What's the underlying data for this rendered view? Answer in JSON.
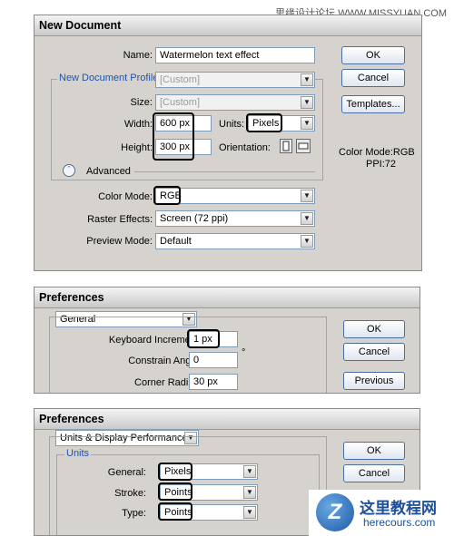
{
  "watermark": {
    "top_right": "思缘设计论坛 WWW.MISSYUAN.COM",
    "logo_cn": "这里教程网",
    "logo_url": "herecours.com",
    "logo_letter": "Z"
  },
  "new_doc": {
    "title": "New Document",
    "name_label": "Name:",
    "name_value": "Watermelon text effect",
    "profile_label": "New Document Profile:",
    "profile_value": "[Custom]",
    "size_label": "Size:",
    "size_value": "[Custom]",
    "width_label": "Width:",
    "width_value": "600 px",
    "units_label": "Units:",
    "units_value": "Pixels",
    "height_label": "Height:",
    "height_value": "300 px",
    "orientation_label": "Orientation:",
    "advanced_label": "Advanced",
    "colormode_label": "Color Mode:",
    "colormode_value": "RGB",
    "raster_label": "Raster Effects:",
    "raster_value": "Screen (72 ppi)",
    "preview_label": "Preview Mode:",
    "preview_value": "Default",
    "ok": "OK",
    "cancel": "Cancel",
    "templates": "Templates...",
    "info_colormode": "Color Mode:RGB",
    "info_ppi": "PPI:72"
  },
  "pref1": {
    "title": "Preferences",
    "section": "General",
    "kb_label": "Keyboard Increment:",
    "kb_value": "1 px",
    "angle_label": "Constrain Angle:",
    "angle_value": "0",
    "degree": "°",
    "radius_label": "Corner Radius:",
    "radius_value": "30 px",
    "ok": "OK",
    "cancel": "Cancel",
    "previous": "Previous"
  },
  "pref2": {
    "title": "Preferences",
    "section": "Units & Display Performance",
    "units_group": "Units",
    "general_label": "General:",
    "general_value": "Pixels",
    "stroke_label": "Stroke:",
    "stroke_value": "Points",
    "type_label": "Type:",
    "type_value": "Points",
    "ok": "OK",
    "cancel": "Cancel"
  }
}
